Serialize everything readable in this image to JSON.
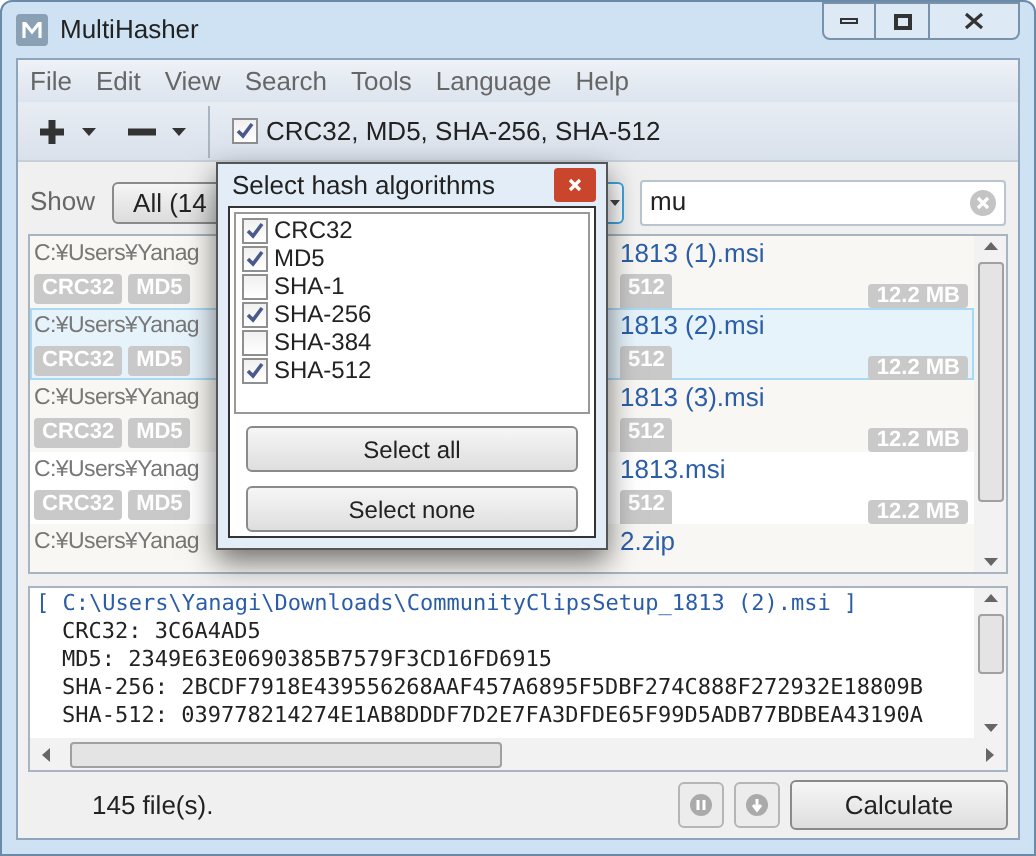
{
  "window": {
    "title": "MultiHasher"
  },
  "menu": [
    "File",
    "Edit",
    "View",
    "Search",
    "Tools",
    "Language",
    "Help"
  ],
  "toolbar": {
    "algorithms_checked": true,
    "algorithms": "CRC32, MD5, SHA-256, SHA-512"
  },
  "filter": {
    "label": "Show",
    "button": "All (14",
    "search_value": "mu"
  },
  "files": [
    {
      "path_start": "C:¥Users¥Yanag",
      "name_end": "1813 (1).msi",
      "tags": [
        "CRC32",
        "MD5"
      ],
      "tags_end": [
        "512"
      ],
      "size": "12.2 MB",
      "selected": false
    },
    {
      "path_start": "C:¥Users¥Yanag",
      "name_end": "1813 (2).msi",
      "tags": [
        "CRC32",
        "MD5"
      ],
      "tags_end": [
        "512"
      ],
      "size": "12.2 MB",
      "selected": true
    },
    {
      "path_start": "C:¥Users¥Yanag",
      "name_end": "1813 (3).msi",
      "tags": [
        "CRC32",
        "MD5"
      ],
      "tags_end": [
        "512"
      ],
      "size": "12.2 MB",
      "selected": false
    },
    {
      "path_start": "C:¥Users¥Yanag",
      "name_end": "1813.msi",
      "tags": [
        "CRC32",
        "MD5"
      ],
      "tags_end": [
        "512"
      ],
      "size": "12.2 MB",
      "selected": false
    },
    {
      "path_start": "C:¥Users¥Yanag",
      "name_end": "2.zip",
      "selected": false
    }
  ],
  "output": {
    "header": "[ C:\\Users\\Yanagi\\Downloads\\CommunityClipsSetup_1813 (2).msi ]",
    "lines": [
      "CRC32: 3C6A4AD5",
      "MD5: 2349E63E0690385B7579F3CD16FD6915",
      "SHA-256: 2BCDF7918E439556268AAF457A6895F5DBF274C888F272932E18809B",
      "SHA-512: 039778214274E1AB8DDDF7D2E7FA3DFDE65F99D5ADB77BDBEA43190A"
    ]
  },
  "status": "145 file(s).",
  "calculate": "Calculate",
  "dialog": {
    "title": "Select hash algorithms",
    "algorithms": [
      {
        "label": "CRC32",
        "checked": true
      },
      {
        "label": "MD5",
        "checked": true
      },
      {
        "label": "SHA-1",
        "checked": false
      },
      {
        "label": "SHA-256",
        "checked": true
      },
      {
        "label": "SHA-384",
        "checked": false
      },
      {
        "label": "SHA-512",
        "checked": true
      }
    ],
    "buttons": [
      "Select all",
      "Select none"
    ]
  }
}
